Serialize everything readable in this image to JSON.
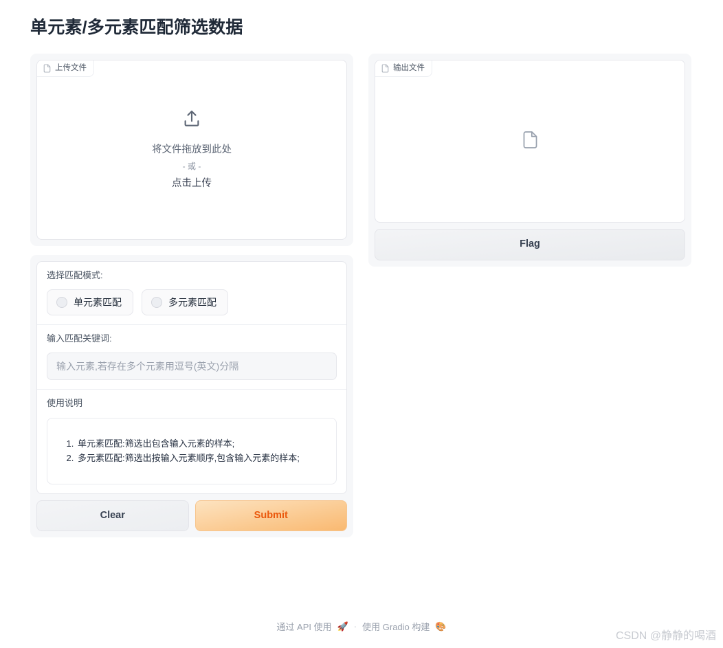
{
  "page": {
    "title": "单元素/多元素匹配筛选数据"
  },
  "upload": {
    "label": "上传文件",
    "label_icon": "file-icon",
    "drop_icon": "upload-icon",
    "drop_text": "将文件拖放到此处",
    "or_text": "- 或 -",
    "click_text": "点击上传"
  },
  "output": {
    "label": "输出文件",
    "label_icon": "file-icon",
    "empty_icon": "file-icon",
    "flag_label": "Flag"
  },
  "form": {
    "mode": {
      "label": "选择匹配模式:",
      "options": [
        {
          "label": "单元素匹配",
          "selected": false
        },
        {
          "label": "多元素匹配",
          "selected": false
        }
      ]
    },
    "keyword": {
      "label": "输入匹配关键词:",
      "value": "",
      "placeholder": "输入元素,若存在多个元素用逗号(英文)分隔"
    },
    "instructions": {
      "label": "使用说明",
      "items": [
        "单元素匹配:筛选出包含输入元素的样本;",
        "多元素匹配:筛选出按输入元素顺序,包含输入元素的样本;"
      ]
    }
  },
  "actions": {
    "clear_label": "Clear",
    "submit_label": "Submit"
  },
  "footer": {
    "api_text": "通过 API 使用",
    "api_icon": "rocket-icon",
    "separator": "·",
    "built_text": "使用 Gradio 构建",
    "built_icon": "gradio-logo-icon"
  },
  "watermark": {
    "text": "CSDN @静静的喝酒"
  },
  "colors": {
    "accent": "#f97316",
    "submit_text": "#ea580c",
    "panel_bg": "#f6f7f9",
    "border": "#e6e7ec"
  }
}
